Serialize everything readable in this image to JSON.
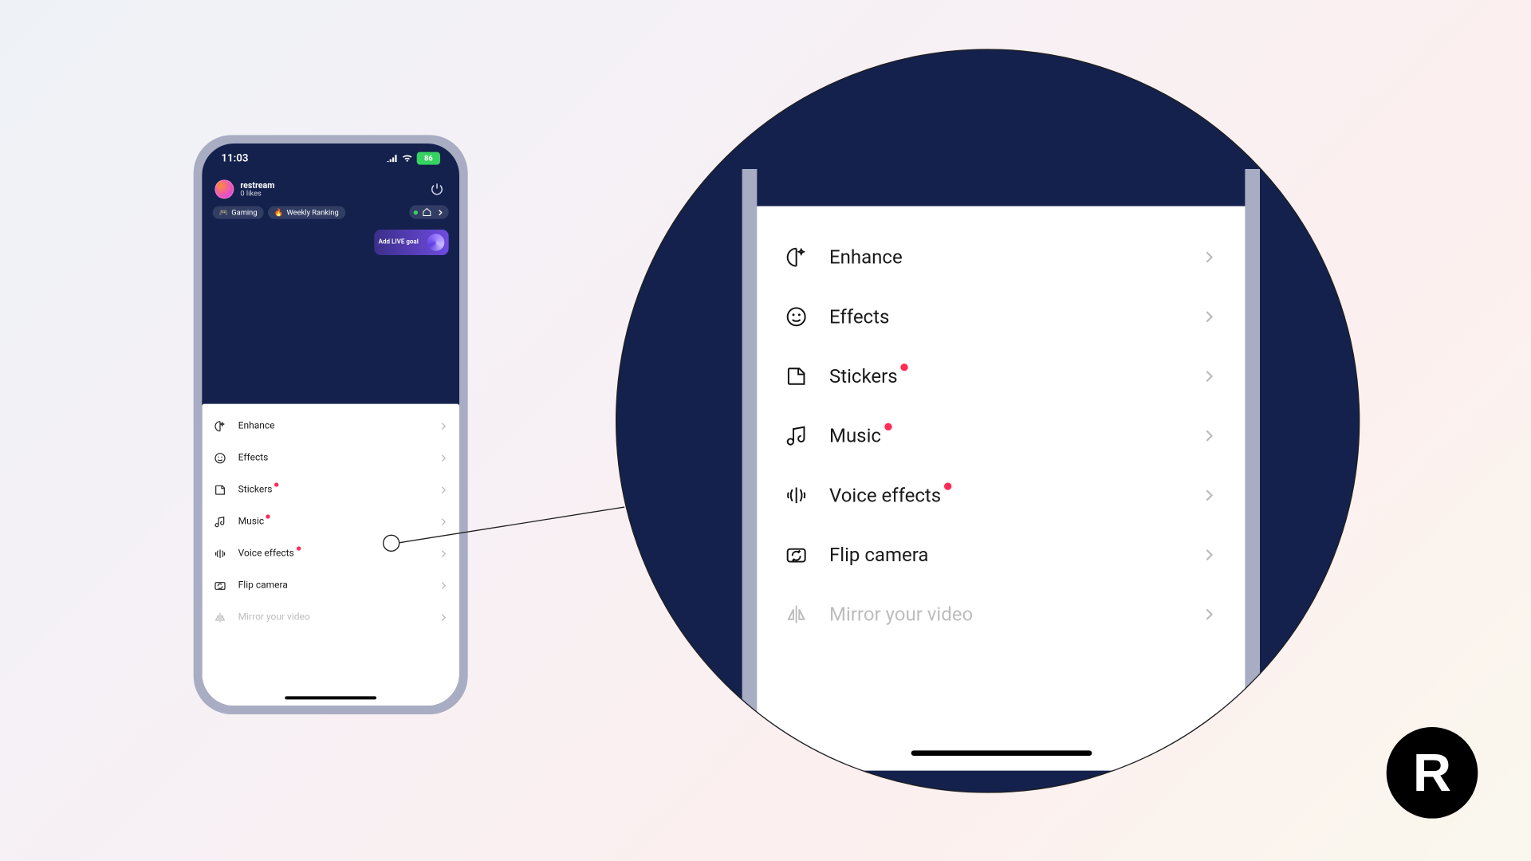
{
  "statusbar": {
    "time": "11:03",
    "battery_label": "86"
  },
  "header": {
    "username": "restream",
    "likes": "0 likes"
  },
  "chips": {
    "gaming": "Gaming",
    "ranking": "Weekly Ranking"
  },
  "goal": {
    "label": "Add LIVE goal"
  },
  "menu": {
    "enhance": "Enhance",
    "effects": "Effects",
    "stickers": "Stickers",
    "music": "Music",
    "voice": "Voice effects",
    "flip": "Flip camera",
    "mirror": "Mirror your video"
  },
  "brand": {
    "letter": "R"
  }
}
